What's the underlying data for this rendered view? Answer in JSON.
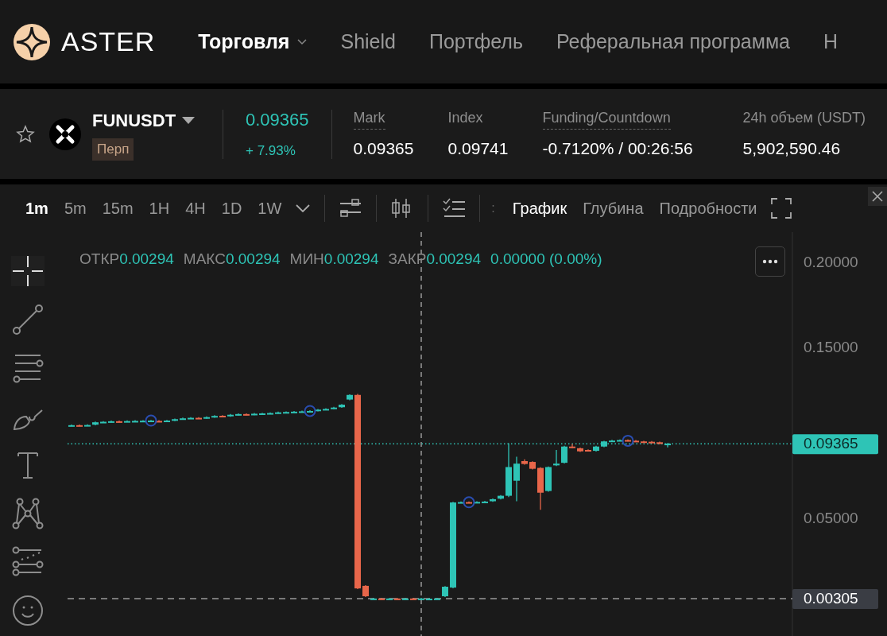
{
  "nav": {
    "logo": "ASTER",
    "items": [
      {
        "label": "Торговля",
        "selected": true,
        "dropdown": true
      },
      {
        "label": "Shield",
        "selected": false,
        "dropdown": false
      },
      {
        "label": "Портфель",
        "selected": false,
        "dropdown": false
      },
      {
        "label": "Реферальная программа",
        "selected": false,
        "dropdown": false
      },
      {
        "label": "Н",
        "selected": false,
        "dropdown": false
      }
    ]
  },
  "ticker": {
    "favorite": false,
    "symbol": "FUNUSDT",
    "tag": "Перп",
    "price": "0.09365",
    "change": "+ 7.93%",
    "stats": [
      {
        "label": "Mark",
        "value": "0.09365",
        "underline": true
      },
      {
        "label": "Index",
        "value": "0.09741",
        "underline": false
      },
      {
        "label": "Funding/Countdown",
        "value": "-0.7120% / 00:26:56",
        "underline": true
      },
      {
        "label": "24h объем (USDT)",
        "value": "5,902,590.46",
        "underline": false
      }
    ]
  },
  "chart_panel": {
    "timeframes": [
      {
        "label": "1m",
        "selected": true
      },
      {
        "label": "5m",
        "selected": false
      },
      {
        "label": "15m",
        "selected": false
      },
      {
        "label": "1H",
        "selected": false
      },
      {
        "label": "4H",
        "selected": false
      },
      {
        "label": "1D",
        "selected": false
      },
      {
        "label": "1W",
        "selected": false
      }
    ],
    "separator": ":",
    "views": [
      {
        "label": "График",
        "selected": true
      },
      {
        "label": "Глубина",
        "selected": false
      },
      {
        "label": "Подробности",
        "selected": false
      }
    ],
    "tools": [
      {
        "kind": "crosshair",
        "selected": true
      },
      {
        "kind": "trendline",
        "selected": false
      },
      {
        "kind": "channel",
        "selected": false
      },
      {
        "kind": "brush",
        "selected": false
      },
      {
        "kind": "text",
        "selected": false
      },
      {
        "kind": "pattern",
        "selected": false
      },
      {
        "kind": "forecast",
        "selected": false
      },
      {
        "kind": "emoji",
        "selected": false
      }
    ],
    "legend": [
      {
        "label": "ОТКР",
        "value": "0.00294"
      },
      {
        "label": "МАКС",
        "value": "0.00294"
      },
      {
        "label": "МИН",
        "value": "0.00294"
      },
      {
        "label": "ЗАКР",
        "value": "0.00294"
      }
    ],
    "legend_change": "0.00000 (0.00%)",
    "axis_labels": [
      "0.20000",
      "0.15000",
      "0.05000"
    ],
    "price_tags": [
      {
        "label": "0.09365",
        "kind": "last"
      },
      {
        "label": "0.00305",
        "kind": "low"
      }
    ]
  }
}
